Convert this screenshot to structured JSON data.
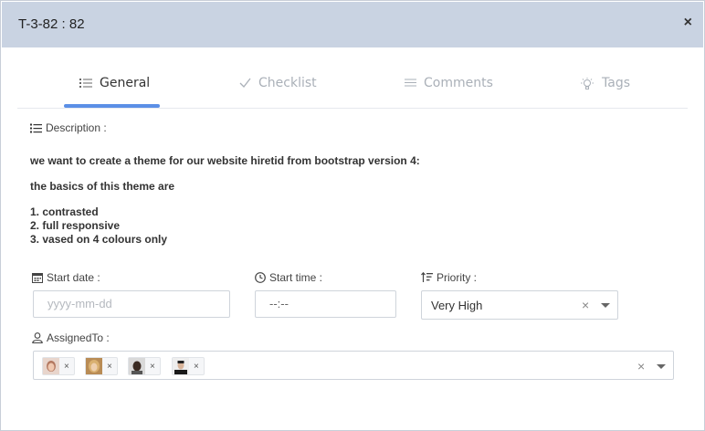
{
  "modal": {
    "title": "T-3-82 : 82",
    "close_label": "×"
  },
  "tabs": [
    {
      "label": "General",
      "icon": "list-icon",
      "active": true
    },
    {
      "label": "Checklist",
      "icon": "check-icon",
      "active": false
    },
    {
      "label": "Comments",
      "icon": "lines-icon",
      "active": false
    },
    {
      "label": "Tags",
      "icon": "lightbulb-icon",
      "active": false
    }
  ],
  "description": {
    "label": "Description :",
    "paragraph1": "we want to create a theme for our website hiretid from bootstrap version 4:",
    "paragraph2": "the basics of this theme are",
    "items": [
      "1. contrasted",
      "2. full responsive",
      "3. vased on 4 colours only"
    ]
  },
  "fields": {
    "start_date": {
      "label": "Start date :",
      "placeholder": "yyyy-mm-dd"
    },
    "start_time": {
      "label": "Start time :",
      "placeholder": "--:--"
    },
    "priority": {
      "label": "Priority :",
      "value": "Very High",
      "clear": "×"
    },
    "assigned_to": {
      "label": "AssignedTo :",
      "clear": "×",
      "remove": "×",
      "chips": [
        "user-1",
        "user-2",
        "user-3",
        "user-4"
      ]
    }
  },
  "colors": {
    "header_bg": "#c9d3e2",
    "accent": "#5b8fe6"
  }
}
